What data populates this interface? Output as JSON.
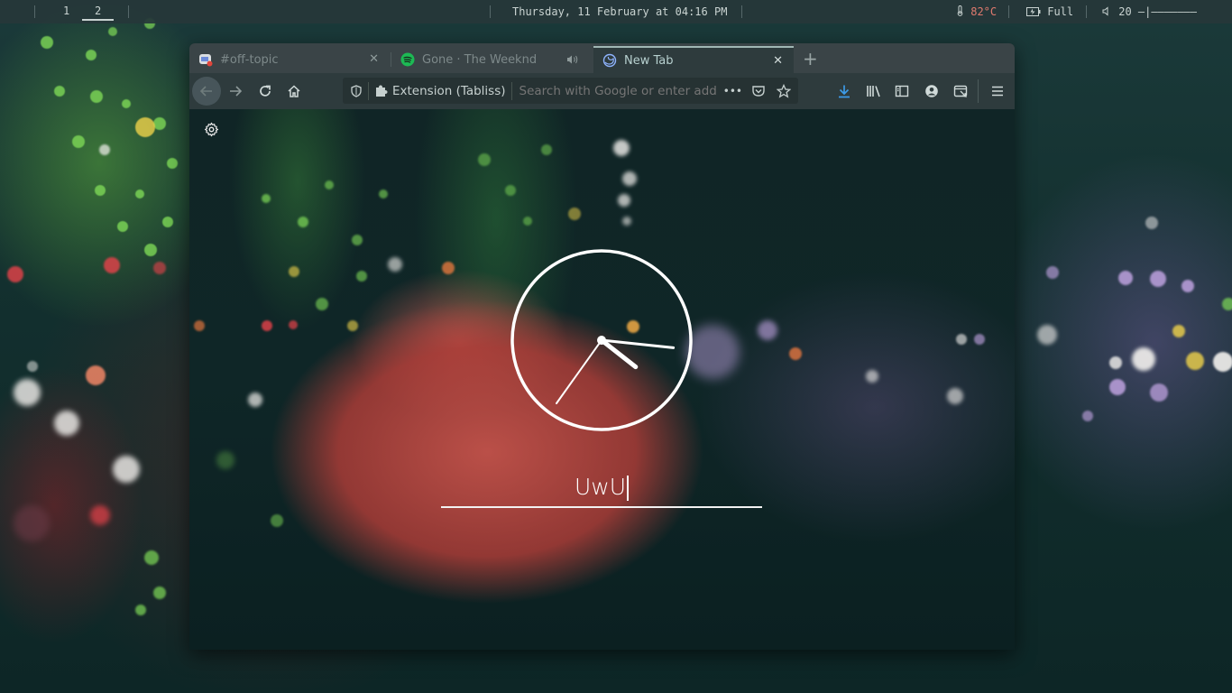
{
  "topbar": {
    "workspaces": [
      "1",
      "2"
    ],
    "active_workspace": "2",
    "datetime": "Thursday, 11 February at 04:16 PM",
    "temperature": "82°C",
    "battery": "Full",
    "volume_level": "20",
    "volume_bar": "—|———————",
    "icons": {
      "temperature": "thermometer-icon",
      "battery": "battery-charging-icon",
      "volume": "speaker-icon"
    }
  },
  "browser": {
    "tabs": [
      {
        "label": "#off-topic",
        "icon": "discord-icon",
        "active": false
      },
      {
        "label": "Gone · The Weeknd",
        "icon": "spotify-icon",
        "active": false,
        "audio": true
      },
      {
        "label": "New Tab",
        "icon": "firefox-icon",
        "active": true
      }
    ],
    "newtab_label": "+",
    "extension_label": "Extension (Tabliss)",
    "search_placeholder": "Search with Google or enter address",
    "page_actions": "•••",
    "accent_color": "#3c9be8"
  },
  "newtab_page": {
    "greeting": "UwU",
    "clock": {
      "hours": 4,
      "minutes": 16
    }
  }
}
